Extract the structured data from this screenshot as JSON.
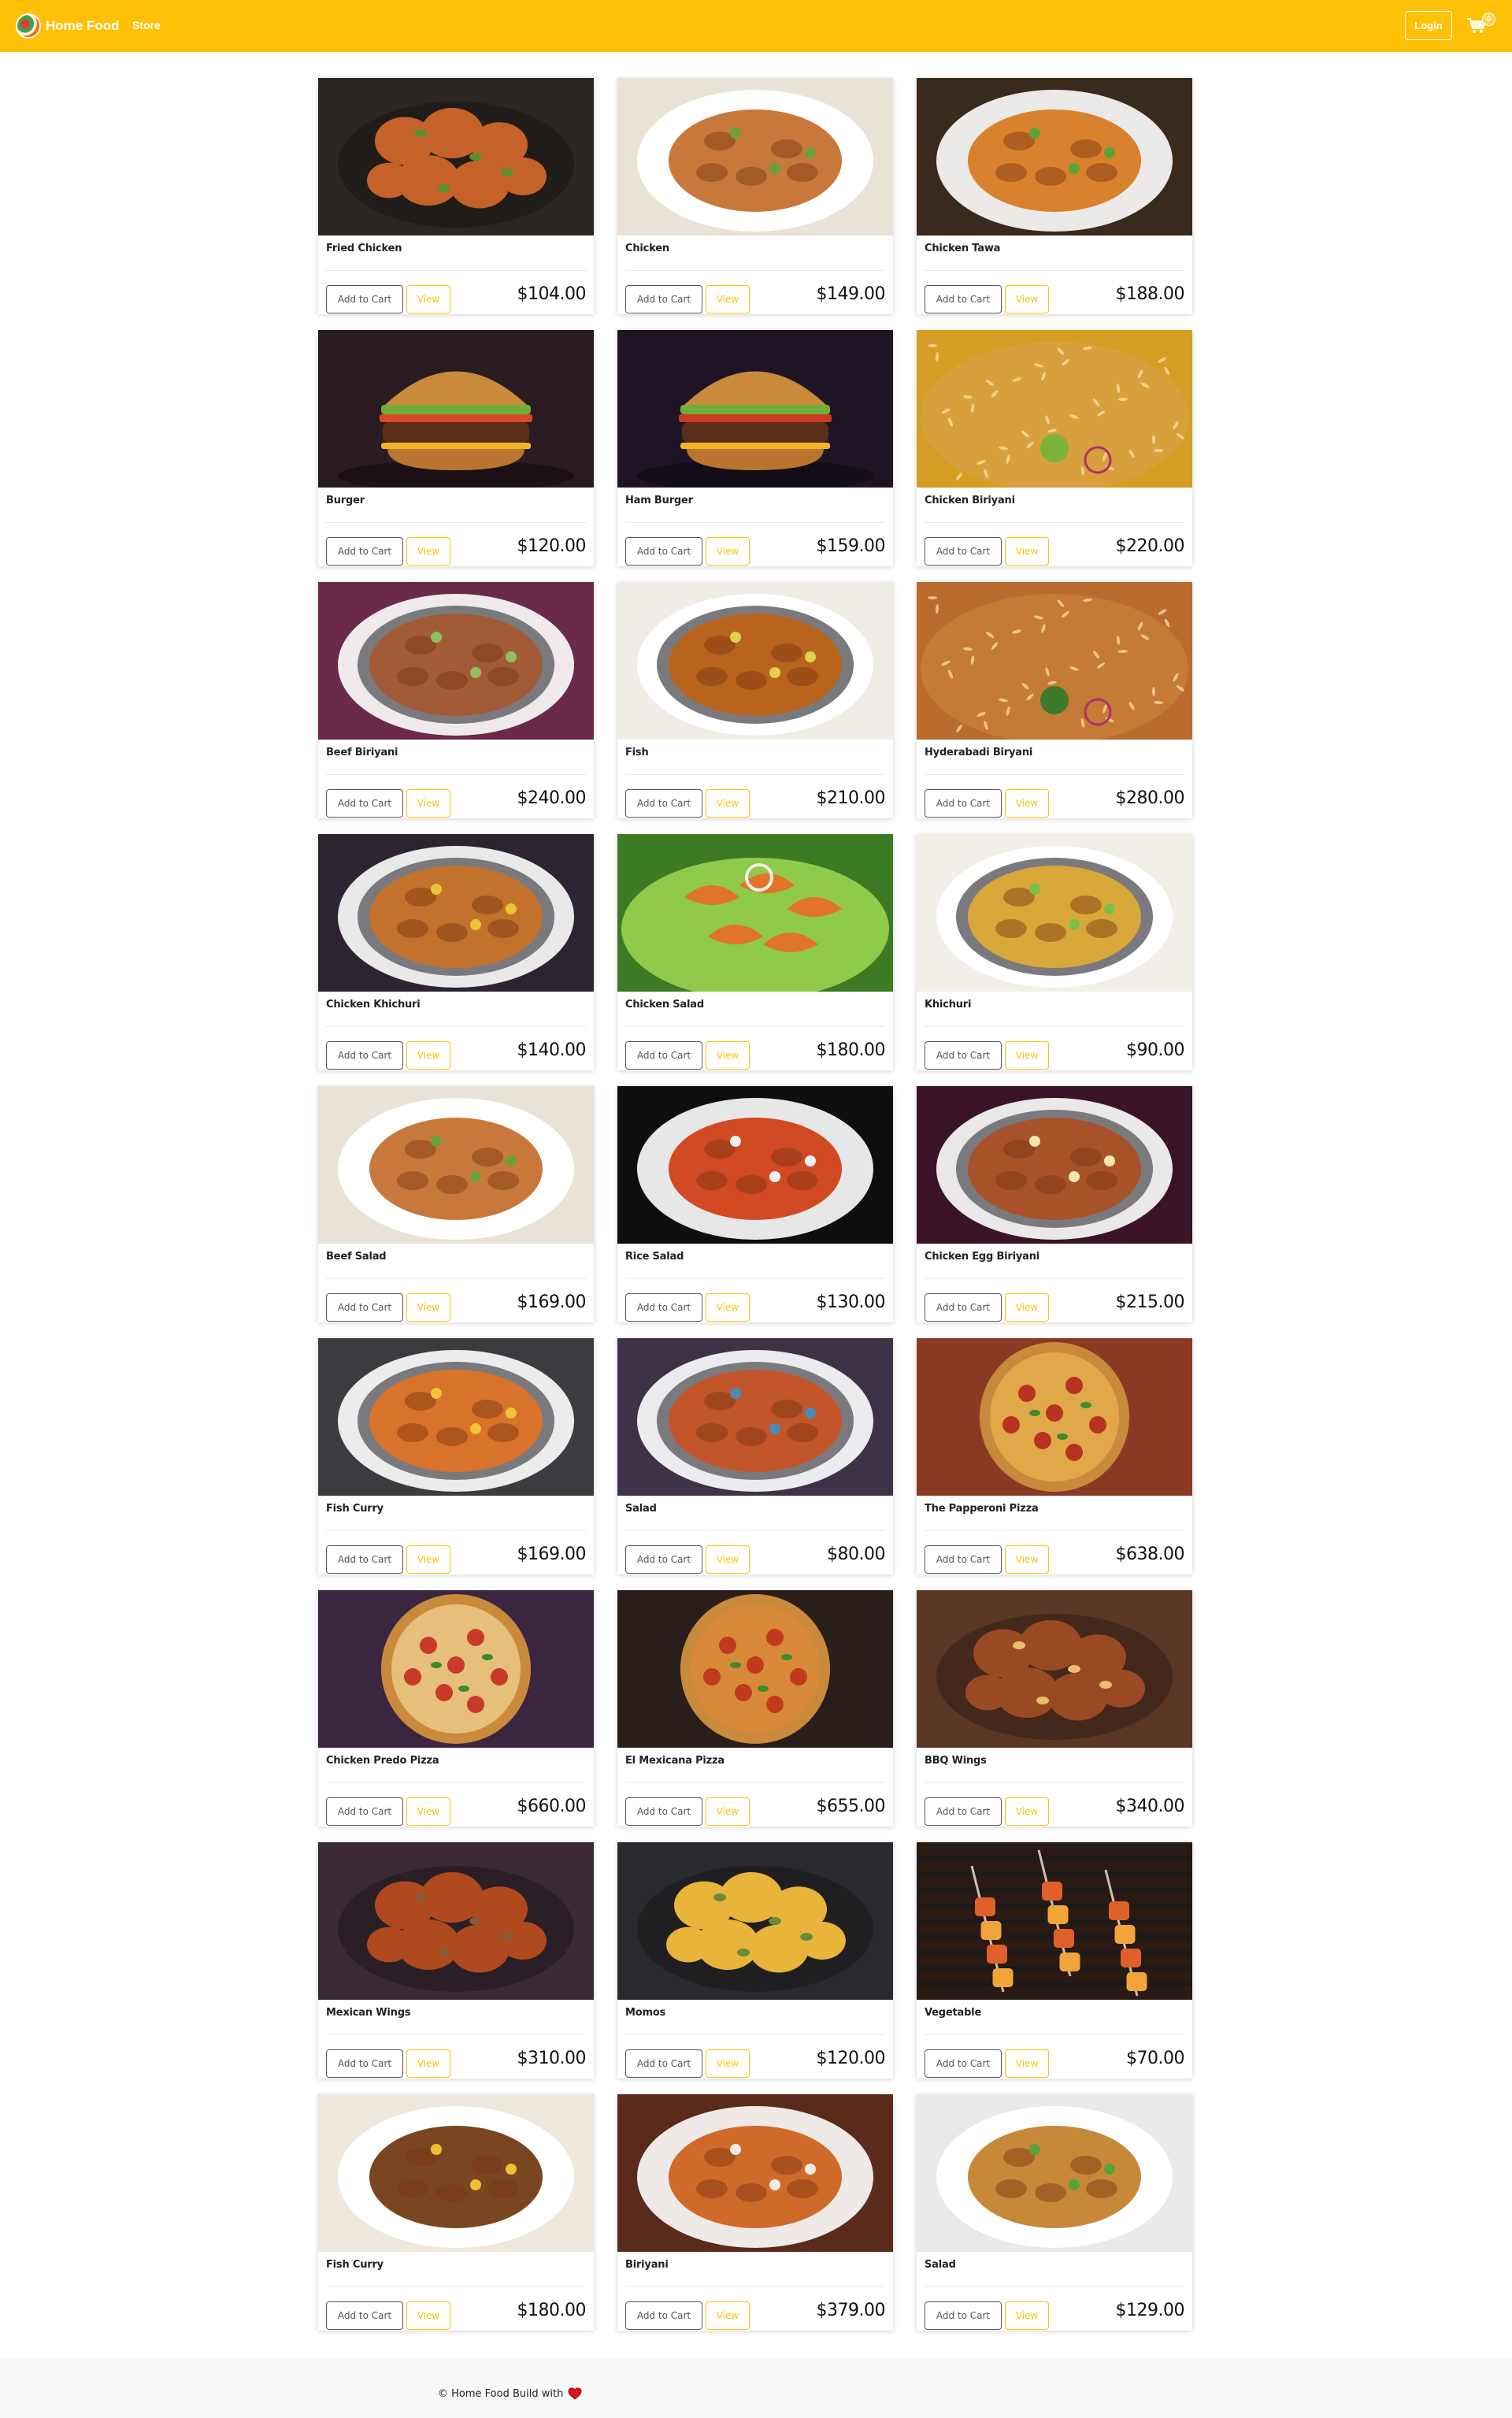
{
  "navbar": {
    "brand_name": "Home Food",
    "store_link": "Store",
    "login_label": "Login",
    "cart_count": "0",
    "background": "#ffc107"
  },
  "products": [
    {
      "name": "Fried Chicken",
      "price": "$104.00",
      "bg": "#2b2622",
      "food": "#c5622a",
      "accent": "#5a8f2e",
      "style": "pieces"
    },
    {
      "name": "Chicken",
      "price": "$149.00",
      "bg": "#e9e2d6",
      "food": "#c9783c",
      "accent": "#6aa239",
      "style": "plate-light"
    },
    {
      "name": "Chicken Tawa",
      "price": "$188.00",
      "bg": "#3a2a1c",
      "food": "#d9822e",
      "accent": "#5fa336",
      "style": "plate"
    },
    {
      "name": "Burger",
      "price": "$120.00",
      "bg": "#2a1a22",
      "food": "#8a4a22",
      "accent": "#d84a24",
      "style": "burger"
    },
    {
      "name": "Ham Burger",
      "price": "$159.00",
      "bg": "#1e1424",
      "food": "#c58a3a",
      "accent": "#cc3a24",
      "style": "burger"
    },
    {
      "name": "Chicken Biriyani",
      "price": "$220.00",
      "bg": "#d39e23",
      "food": "#d7a03c",
      "accent": "#7bb33a",
      "style": "rice-light"
    },
    {
      "name": "Beef Biriyani",
      "price": "$240.00",
      "bg": "#6b2a4a",
      "food": "#a35a36",
      "accent": "#8fc25a",
      "style": "bowl"
    },
    {
      "name": "Fish",
      "price": "$210.00",
      "bg": "#f0ede6",
      "food": "#b8641e",
      "accent": "#e0d24c",
      "style": "bowl-light"
    },
    {
      "name": "Hyderabadi Biryani",
      "price": "$280.00",
      "bg": "#b96c2e",
      "food": "#c57a36",
      "accent": "#3d7a2a",
      "style": "rice"
    },
    {
      "name": "Chicken Khichuri",
      "price": "$140.00",
      "bg": "#2c2430",
      "food": "#c2722c",
      "accent": "#e8c43a",
      "style": "bowl"
    },
    {
      "name": "Chicken Salad",
      "price": "$180.00",
      "bg": "#3c7a24",
      "food": "#e2742a",
      "accent": "#8fca4a",
      "style": "salad"
    },
    {
      "name": "Khichuri",
      "price": "$90.00",
      "bg": "#f2efe9",
      "food": "#d8a83a",
      "accent": "#7bbf4a",
      "style": "bowl-light"
    },
    {
      "name": "Beef Salad",
      "price": "$169.00",
      "bg": "#e9e2d6",
      "food": "#c9783c",
      "accent": "#6aa239",
      "style": "plate-light"
    },
    {
      "name": "Rice Salad",
      "price": "$130.00",
      "bg": "#0e0e10",
      "food": "#d14a24",
      "accent": "#f0f0f0",
      "style": "plate"
    },
    {
      "name": "Chicken Egg Biriyani",
      "price": "$215.00",
      "bg": "#3a1426",
      "food": "#a8522a",
      "accent": "#f3e4b0",
      "style": "bowl"
    },
    {
      "name": "Fish Curry",
      "price": "$169.00",
      "bg": "#3c3c40",
      "food": "#d9722a",
      "accent": "#f0c23a",
      "style": "bowl"
    },
    {
      "name": "Salad",
      "price": "$80.00",
      "bg": "#3e3248",
      "food": "#c2562a",
      "accent": "#4a8ab8",
      "style": "bowl"
    },
    {
      "name": "The Papperoni Pizza",
      "price": "$638.00",
      "bg": "#8a3a24",
      "food": "#e0a848",
      "accent": "#b83222",
      "style": "pizza"
    },
    {
      "name": "Chicken Predo Pizza",
      "price": "$660.00",
      "bg": "#3a2640",
      "food": "#e6c07a",
      "accent": "#c83a2a",
      "style": "pizza"
    },
    {
      "name": "El Mexicana Pizza",
      "price": "$655.00",
      "bg": "#2a1e1a",
      "food": "#d88a3a",
      "accent": "#c23a1e",
      "style": "pizza"
    },
    {
      "name": "BBQ Wings",
      "price": "$340.00",
      "bg": "#5a3624",
      "food": "#9a4a22",
      "accent": "#e8c06a",
      "style": "pieces"
    },
    {
      "name": "Mexican Wings",
      "price": "$310.00",
      "bg": "#3a2a34",
      "food": "#b04a1e",
      "accent": "#8a5a36",
      "style": "pieces"
    },
    {
      "name": "Momos",
      "price": "$120.00",
      "bg": "#2a2a2e",
      "food": "#e8b43a",
      "accent": "#6a8a3a",
      "style": "pieces"
    },
    {
      "name": "Vegetable",
      "price": "$70.00",
      "bg": "#2a1a14",
      "food": "#e0602a",
      "accent": "#f2a43a",
      "style": "grill"
    },
    {
      "name": "Fish Curry",
      "price": "$180.00",
      "bg": "#eee8de",
      "food": "#7a4622",
      "accent": "#f0c030",
      "style": "plate-light"
    },
    {
      "name": "Biriyani",
      "price": "$379.00",
      "bg": "#5a2a1a",
      "food": "#d06a2a",
      "accent": "#f0ece4",
      "style": "plate"
    },
    {
      "name": "Salad",
      "price": "$129.00",
      "bg": "#e8eaec",
      "food": "#c8883a",
      "accent": "#5aa236",
      "style": "plate-light"
    }
  ],
  "labels": {
    "add_to_cart": "Add to Cart",
    "view": "View"
  },
  "footer": {
    "text": "© Home Food Build with",
    "heart_color": "#e0101a"
  }
}
